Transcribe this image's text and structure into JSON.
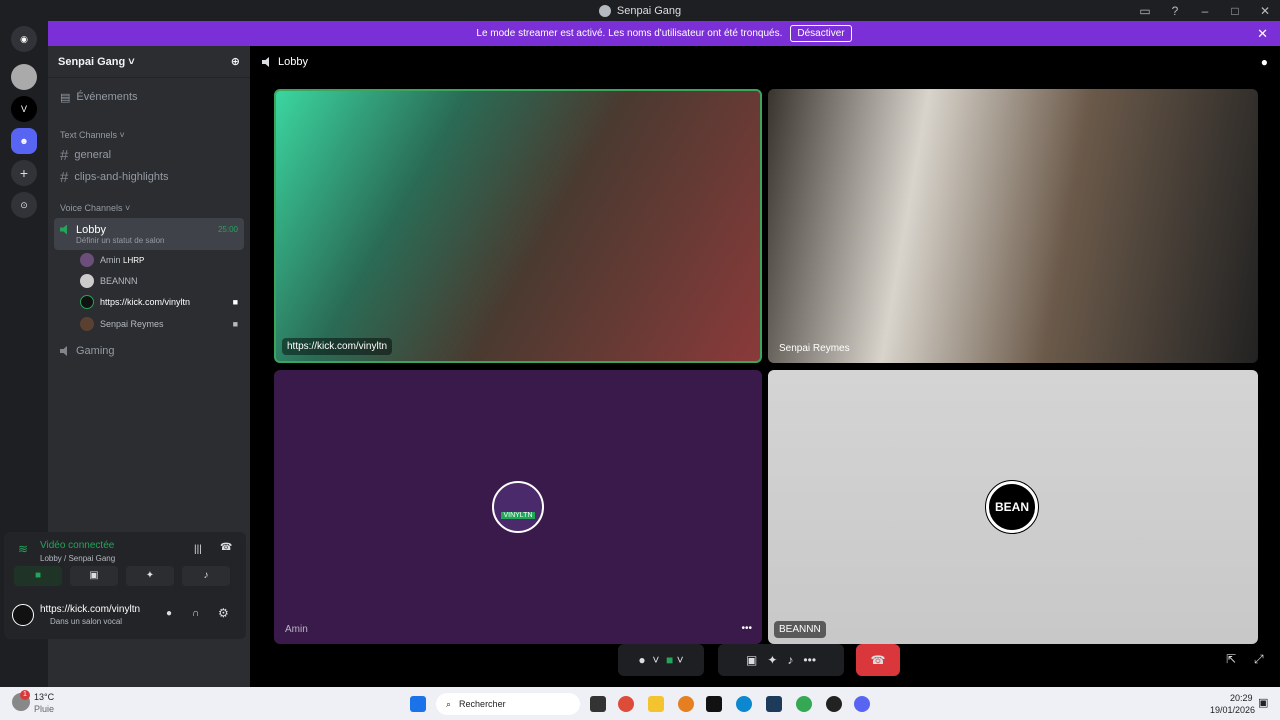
{
  "window": {
    "title": "Senpai Gang"
  },
  "banner": {
    "text": "Le mode streamer est activé. Les noms d'utilisateur ont été tronqués.",
    "button": "Désactiver"
  },
  "sidebar": {
    "server_name": "Senpai Gang",
    "events": "Événements",
    "text_category": "Text Channels",
    "text_channels": [
      "general",
      "clips-and-highlights"
    ],
    "voice_category": "Voice Channels",
    "lobby": {
      "name": "Lobby",
      "status": "Définir un statut de salon",
      "timer": "25:00"
    },
    "members": [
      "Amin",
      "BEANNN",
      "https://kick.com/vinyltn",
      "Senpai Reymes"
    ],
    "amin_tag": "LHRP",
    "gaming": "Gaming"
  },
  "voice_panel": {
    "status": "Vidéo connectée",
    "location": "Lobby / Senpai Gang"
  },
  "user_panel": {
    "name": "https://kick.com/vinyltn",
    "status": "Dans un salon vocal"
  },
  "main": {
    "channel": "Lobby",
    "tiles": [
      {
        "label": "https://kick.com/vinyltn"
      },
      {
        "label": "Senpai Reymes"
      },
      {
        "label": "Amin",
        "avatar_text": "VINYLTN"
      },
      {
        "label": "BEANNN",
        "logo_text": "BEAN"
      }
    ]
  },
  "taskbar": {
    "weather_temp": "13°C",
    "weather_desc": "Pluie",
    "search": "Rechercher",
    "time": "20:29",
    "date": "19/01/2026",
    "badge": "1"
  },
  "colors": {
    "accent": "#7b2fd6",
    "green": "#23a55a",
    "red": "#da373c"
  }
}
